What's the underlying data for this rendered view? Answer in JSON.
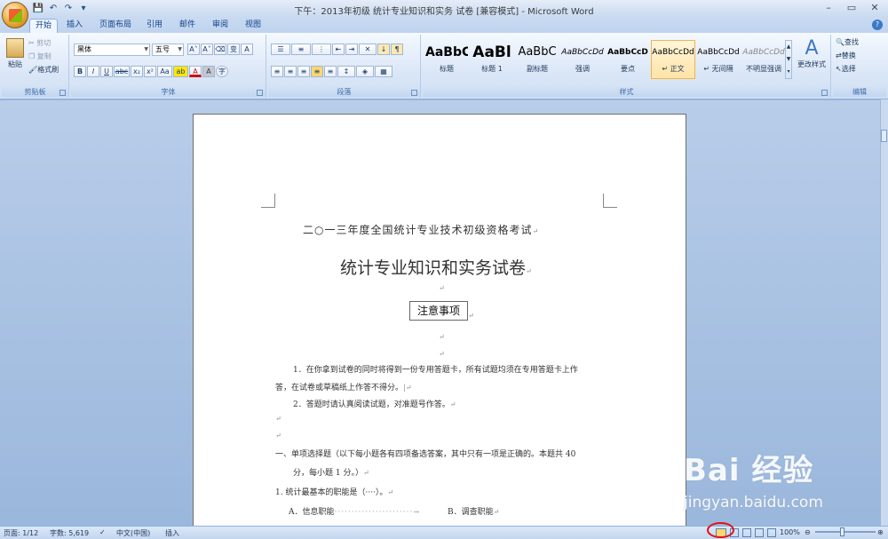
{
  "window": {
    "title": "下午：2013年初级 统计专业知识和实务 试卷 [兼容模式] - Microsoft Word",
    "controls": [
      "–",
      "▭",
      "✕"
    ]
  },
  "qat": [
    "💾",
    "↶",
    "↷",
    "▾"
  ],
  "tabs": [
    "开始",
    "插入",
    "页面布局",
    "引用",
    "邮件",
    "审阅",
    "视图"
  ],
  "clipboard": {
    "paste": "粘贴",
    "cut": "剪切",
    "copy": "复制",
    "format_painter": "格式刷",
    "label": "剪贴板"
  },
  "font": {
    "name": "黑体",
    "size": "五号",
    "label": "字体",
    "buttons": [
      "B",
      "I",
      "U",
      "abc",
      "x₂",
      "x²",
      "Aa",
      "ab",
      "A",
      "A",
      "字"
    ]
  },
  "paragraph": {
    "label": "段落"
  },
  "styles": {
    "label": "样式",
    "items": [
      {
        "preview": "AaBbC",
        "name": "标题"
      },
      {
        "preview": "AaBl",
        "name": "标题 1"
      },
      {
        "preview": "AaBbC",
        "name": "副标题"
      },
      {
        "preview": "AaBbCcDd",
        "name": "强调"
      },
      {
        "preview": "AaBbCcD",
        "name": "要点"
      },
      {
        "preview": "AaBbCcDd",
        "name": "↵ 正文"
      },
      {
        "preview": "AaBbCcDd",
        "name": "↵ 无间隔"
      },
      {
        "preview": "AaBbCcDd",
        "name": "不明显强调"
      }
    ],
    "change": "更改样式"
  },
  "editing": {
    "label": "编辑",
    "find": "查找",
    "replace": "替换",
    "select": "选择"
  },
  "doc": {
    "line1": "二○一三年度全国统计专业技术初级资格考试",
    "title": "统计专业知识和实务试卷",
    "notice": "注意事项",
    "p1a": "1．在你拿到试卷的同时将得到一份专用答题卡，所有试题均须在专用答题卡上作",
    "p1b": "答，在试卷或草稿纸上作答不得分。",
    "p2": "2．答题时请认真阅读试题，对准题号作答。",
    "sec1a": "一、单项选择题（以下每小题各有四项备选答案，其中只有一项是正确的。本题共 40",
    "sec1b": "分，每小题 1 分。）",
    "q1": "1. 统计最基本的职能是（····）。",
    "optA": "A．信息职能",
    "optB": "B．调查职能"
  },
  "status": {
    "page": "页面: 1/12",
    "words": "字数: 5,619",
    "lang": "中文(中国)",
    "mode": "插入",
    "zoom": "100%"
  },
  "watermark": {
    "brand": "Bai 经验",
    "url": "jingyan.baidu.com"
  }
}
